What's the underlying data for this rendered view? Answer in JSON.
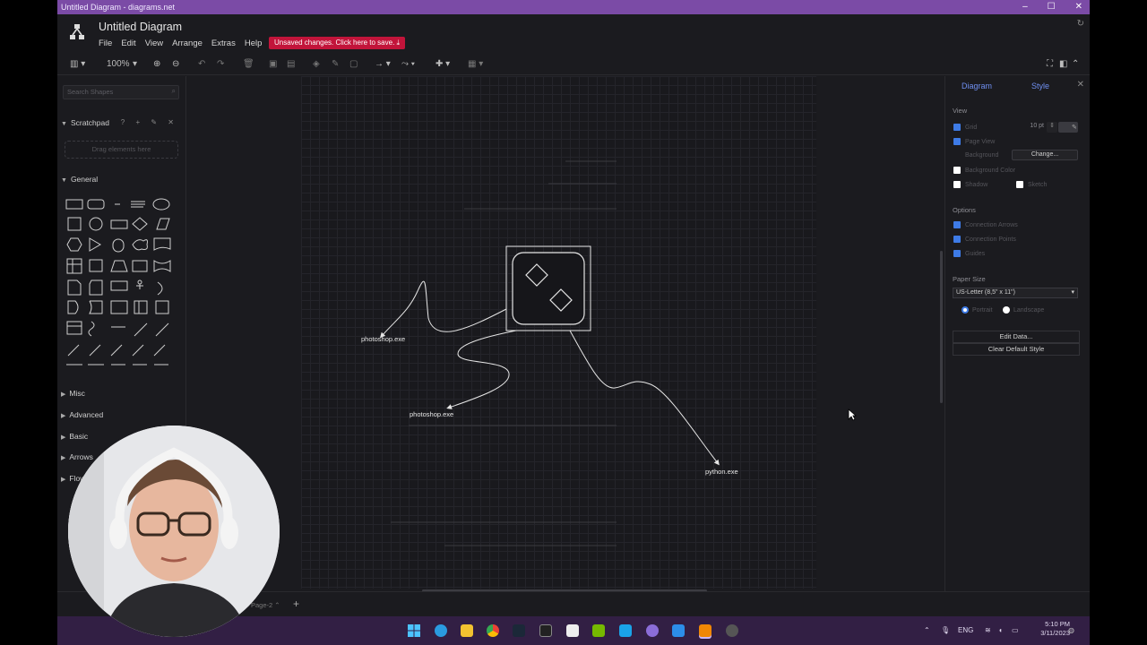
{
  "window": {
    "title": "Untitled Diagram - diagrams.net",
    "controls": [
      "–",
      "☐",
      "✕"
    ]
  },
  "app": {
    "doc_title": "Untitled Diagram",
    "menu": [
      "File",
      "Edit",
      "View",
      "Arrange",
      "Extras",
      "Help"
    ],
    "unsaved_notice": "Unsaved changes. Click here to save."
  },
  "toolbar": {
    "zoom": "100%"
  },
  "left_panel": {
    "search_placeholder": "Search Shapes",
    "scratchpad_title": "Scratchpad",
    "scratchpad_tools": "? + ✎ ✕",
    "drop_hint": "Drag elements here",
    "sections": [
      "General",
      "Misc",
      "Advanced",
      "Basic",
      "Arrows",
      "Flow"
    ]
  },
  "diagram": {
    "labels": {
      "photoshop_1": "photoshop.exe",
      "photoshop_2": "photoshop.exe",
      "python": "python.exe"
    }
  },
  "right_panel": {
    "tabs": [
      "Diagram",
      "Style"
    ],
    "view_heading": "View",
    "grid_label": "Grid",
    "grid_size": "10 pt",
    "page_view_label": "Page View",
    "background_label": "Background",
    "change_button": "Change...",
    "background_color_label": "Background Color",
    "shadow_label": "Shadow",
    "sketch_label": "Sketch",
    "options_heading": "Options",
    "options": [
      "Connection Arrows",
      "Connection Points",
      "Guides"
    ],
    "paper_size_heading": "Paper Size",
    "paper_size_value": "US-Letter (8,5\" x 11\")",
    "portrait_label": "Portrait",
    "landscape_label": "Landscape",
    "edit_data_button": "Edit Data...",
    "clear_style_button": "Clear Default Style"
  },
  "bottom": {
    "page_tab": "Page-2"
  },
  "taskbar": {
    "language": "ENG",
    "time": "5:10 PM",
    "date": "3/11/2023"
  }
}
